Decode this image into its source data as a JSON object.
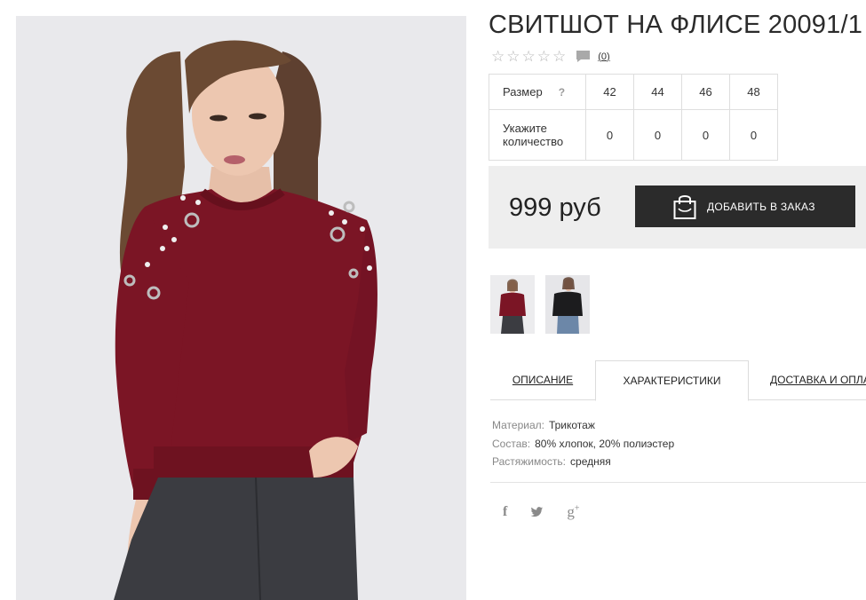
{
  "product": {
    "title": "СВИТШОТ НА ФЛИСЕ 20091/1",
    "reviews_count": "(0)",
    "rating_stars": 0
  },
  "icons": {
    "star": "star-outline-icon",
    "review": "speech-bubble-icon",
    "bag": "shopping-bag-icon",
    "facebook": "facebook-icon",
    "twitter": "twitter-icon",
    "google_plus": "google-plus-icon"
  },
  "size_table": {
    "size_label": "Размер",
    "help": "?",
    "sizes": [
      "42",
      "44",
      "46",
      "48"
    ],
    "qty_label": "Укажите количество",
    "quantities": [
      "0",
      "0",
      "0",
      "0"
    ]
  },
  "buy": {
    "price": "999 руб",
    "add_button": "ДОБАВИТЬ В ЗАКАЗ"
  },
  "tabs": [
    "ОПИСАНИЕ",
    "ХАРАКТЕРИСТИКИ",
    "ДОСТАВКА И ОПЛАТА"
  ],
  "active_tab": "ХАРАКТЕРИСТИКИ",
  "specs": [
    {
      "key": "Материал:",
      "value": "Трикотаж"
    },
    {
      "key": "Состав:",
      "value": "80% хлопок, 20% полиэстер"
    },
    {
      "key": "Растяжимость:",
      "value": "средняя"
    }
  ],
  "social": {
    "facebook": "f",
    "twitter": "🐦",
    "google_plus": "g"
  },
  "colors": {
    "sweatshirt": "#7b1525",
    "button_bg": "#2b2b2b",
    "buybox_bg": "#eeeeee"
  }
}
